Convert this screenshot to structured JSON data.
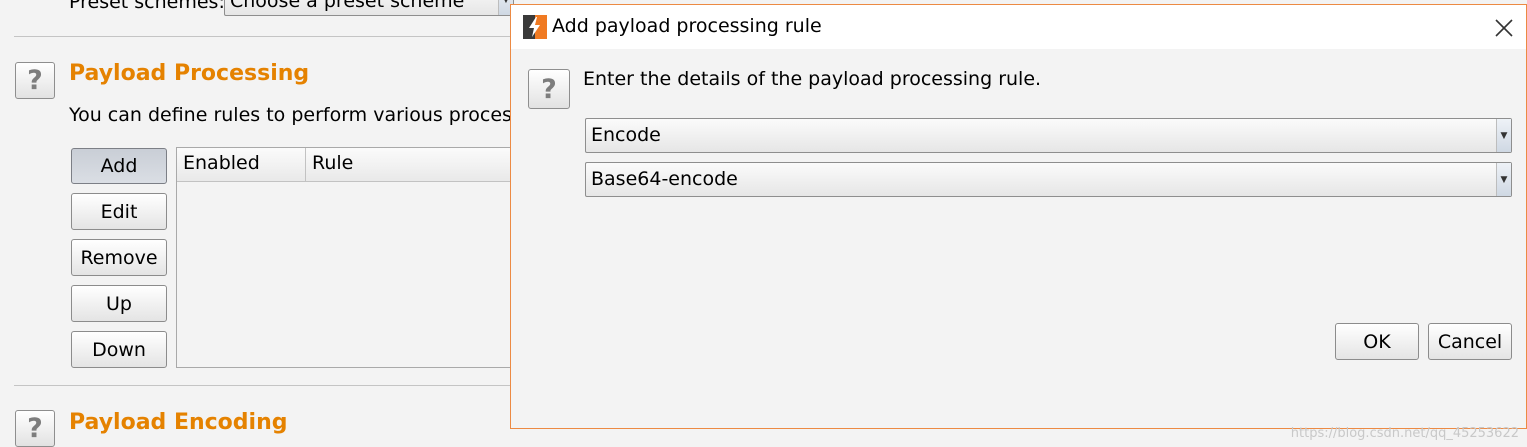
{
  "background": {
    "preset_label": "Preset schemes:",
    "preset_value": "Choose a preset scheme",
    "processing": {
      "title": "Payload Processing",
      "description": "You can define rules to perform various processing",
      "buttons": {
        "add": "Add",
        "edit": "Edit",
        "remove": "Remove",
        "up": "Up",
        "down": "Down"
      },
      "table_headers": [
        "Enabled",
        "Rule"
      ]
    },
    "encoding": {
      "title": "Payload Encoding"
    }
  },
  "dialog": {
    "title": "Add payload processing rule",
    "prompt": "Enter the details of the payload processing rule.",
    "rule_type": "Encode",
    "rule_option": "Base64-encode",
    "ok_label": "OK",
    "cancel_label": "Cancel"
  },
  "watermark": "https://blog.csdn.net/qq_45253622",
  "colors": {
    "section_title": "#e58200",
    "dialog_border": "#ec8a43",
    "logo": "#f07a22"
  }
}
